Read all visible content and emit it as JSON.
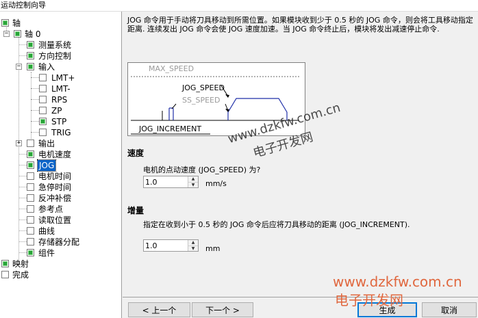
{
  "window": {
    "title": "运动控制向导"
  },
  "tree": {
    "root_axis": "轴",
    "axis0": "轴 0",
    "measurement": "测量系统",
    "direction": "方向控制",
    "input": "输入",
    "inputs": [
      "LMT+",
      "LMT-",
      "RPS",
      "ZP",
      "STP",
      "TRIG"
    ],
    "output": "输出",
    "motor_speed": "电机速度",
    "jog": "JOG",
    "motor_time": "电机时间",
    "estop_time": "急停时间",
    "backlash": "反冲补偿",
    "reference": "参考点",
    "read_pos": "读取位置",
    "curve": "曲线",
    "memory": "存储器分配",
    "component": "组件",
    "mapping": "映射",
    "finish": "完成"
  },
  "main": {
    "description": "JOG 命令用于手动将刀具移动到所需位置。如果模块收到少于 0.5 秒的 JOG 命令，则会将工具移动指定距离. 连续发出 JOG 命令会使 JOG 速度加速。当 JOG 命令终止后，模块将发出减速停止命令.",
    "diagram": {
      "max_speed": "MAX_SPEED",
      "jog_speed": "JOG_SPEED",
      "ss_speed": "SS_SPEED",
      "jog_increment": "JOG_INCREMENT"
    },
    "speed_section": "速度",
    "speed_question": "电机的点动速度 (JOG_SPEED) 为?",
    "speed_value": "1.0",
    "speed_unit": "mm/s",
    "incr_section": "增量",
    "incr_question": "指定在收到小于 0.5 秒的 JOG 命令后应将刀具移动的距离 (JOG_INCREMENT).",
    "incr_value": "1.0",
    "incr_unit": "mm"
  },
  "buttons": {
    "prev": "< 上一个",
    "next": "下一个 >",
    "finish": "生成",
    "cancel": "取消"
  },
  "watermark": {
    "url": "www.dzkfw.com.cn",
    "name": "电子开发网"
  },
  "colors": {
    "selection": "#0a64c8",
    "check": "#2aa33a",
    "diagram_line": "#1f2fa8"
  }
}
